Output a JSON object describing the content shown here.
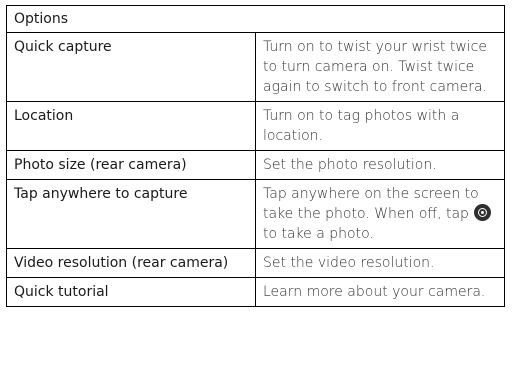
{
  "table": {
    "header": "Options",
    "rows": [
      {
        "name": "Quick capture",
        "description": "Turn on to twist your wrist twice to turn camera on. Twist twice again to switch to front camera."
      },
      {
        "name": "Location",
        "description": "Turn on to tag photos with a location."
      },
      {
        "name": "Photo size (rear camera)",
        "description": "Set the photo resolution."
      },
      {
        "name": "Tap anywhere to capture",
        "description_before_icon": "Tap anywhere on the screen to take the photo. When off, tap",
        "description_after_icon": "to take a photo.",
        "icon": "camera-shutter-icon"
      },
      {
        "name": "Video resolution (rear camera)",
        "description": "Set the video resolution."
      },
      {
        "name": "Quick tutorial",
        "description": "Learn more about your camera."
      }
    ]
  }
}
